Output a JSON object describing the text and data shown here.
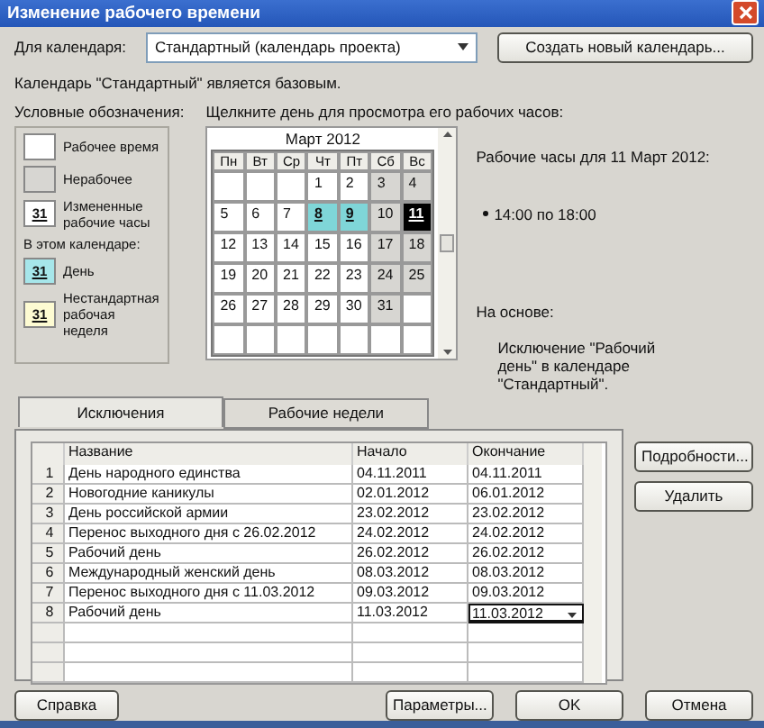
{
  "window": {
    "title": "Изменение рабочего времени"
  },
  "calendar_field": {
    "label": "Для календаря:",
    "value": "Стандартный (календарь проекта)"
  },
  "create_button": "Создать новый календарь...",
  "base_note": "Календарь \"Стандартный\" является базовым.",
  "legend": {
    "title": "Условные обозначения:",
    "items": [
      {
        "kind": "working",
        "label": "Рабочее время"
      },
      {
        "kind": "nonworking",
        "label": "Нерабочее"
      },
      {
        "kind": "changed",
        "mark": "31",
        "label": "Измененные рабочие часы"
      },
      {
        "kind": "heading",
        "label": "В этом календаре:"
      },
      {
        "kind": "exception",
        "mark": "31",
        "label": "День"
      },
      {
        "kind": "nonstandard",
        "mark": "31",
        "label": "Нестандартная рабочая неделя"
      }
    ]
  },
  "calendar": {
    "hint": "Щелкните день для просмотра его рабочих часов:",
    "month": "Март 2012",
    "weekdays": [
      "Пн",
      "Вт",
      "Ср",
      "Чт",
      "Пт",
      "Сб",
      "Вс"
    ],
    "weeks": [
      [
        {
          "kind": "empty",
          "selected": false
        },
        {
          "kind": "empty",
          "selected": false
        },
        {
          "kind": "empty",
          "selected": false
        },
        {
          "day": "1",
          "kind": "working",
          "selected": false
        },
        {
          "day": "2",
          "kind": "working",
          "selected": false
        },
        {
          "day": "3",
          "kind": "nonworking",
          "selected": false
        },
        {
          "day": "4",
          "kind": "nonworking",
          "selected": false
        }
      ],
      [
        {
          "day": "5",
          "kind": "working",
          "selected": false
        },
        {
          "day": "6",
          "kind": "working",
          "selected": false
        },
        {
          "day": "7",
          "kind": "working",
          "selected": false
        },
        {
          "day": "8",
          "kind": "exception",
          "selected": false
        },
        {
          "day": "9",
          "kind": "exception",
          "selected": false
        },
        {
          "day": "10",
          "kind": "nonworking",
          "selected": false
        },
        {
          "day": "11",
          "kind": "exception",
          "selected": true
        }
      ],
      [
        {
          "day": "12",
          "kind": "working",
          "selected": false
        },
        {
          "day": "13",
          "kind": "working",
          "selected": false
        },
        {
          "day": "14",
          "kind": "working",
          "selected": false
        },
        {
          "day": "15",
          "kind": "working",
          "selected": false
        },
        {
          "day": "16",
          "kind": "working",
          "selected": false
        },
        {
          "day": "17",
          "kind": "nonworking",
          "selected": false
        },
        {
          "day": "18",
          "kind": "nonworking",
          "selected": false
        }
      ],
      [
        {
          "day": "19",
          "kind": "working",
          "selected": false
        },
        {
          "day": "20",
          "kind": "working",
          "selected": false
        },
        {
          "day": "21",
          "kind": "working",
          "selected": false
        },
        {
          "day": "22",
          "kind": "working",
          "selected": false
        },
        {
          "day": "23",
          "kind": "working",
          "selected": false
        },
        {
          "day": "24",
          "kind": "nonworking",
          "selected": false
        },
        {
          "day": "25",
          "kind": "nonworking",
          "selected": false
        }
      ],
      [
        {
          "day": "26",
          "kind": "working",
          "selected": false
        },
        {
          "day": "27",
          "kind": "working",
          "selected": false
        },
        {
          "day": "28",
          "kind": "working",
          "selected": false
        },
        {
          "day": "29",
          "kind": "working",
          "selected": false
        },
        {
          "day": "30",
          "kind": "working",
          "selected": false
        },
        {
          "day": "31",
          "kind": "nonworking",
          "selected": false
        },
        {
          "kind": "empty",
          "selected": false
        }
      ],
      [
        {
          "kind": "empty",
          "selected": false
        },
        {
          "kind": "empty",
          "selected": false
        },
        {
          "kind": "empty",
          "selected": false
        },
        {
          "kind": "empty",
          "selected": false
        },
        {
          "kind": "empty",
          "selected": false
        },
        {
          "kind": "empty",
          "selected": false
        },
        {
          "kind": "empty",
          "selected": false
        }
      ]
    ]
  },
  "hours": {
    "title": "Рабочие часы для 11 Март 2012:",
    "items": [
      "14:00 по 18:00"
    ]
  },
  "based_on": {
    "title": "На основе:",
    "text": "Исключение \"Рабочий день\" в календаре \"Стандартный\"."
  },
  "tabs": [
    {
      "label": "Исключения",
      "selected": true
    },
    {
      "label": "Рабочие недели",
      "selected": false
    }
  ],
  "table": {
    "columns": [
      "Название",
      "Начало",
      "Окончание"
    ],
    "rows": [
      {
        "num": "1",
        "name": "День народного единства",
        "start": "04.11.2011",
        "end": "04.11.2011",
        "selected": false
      },
      {
        "num": "2",
        "name": "Новогодние каникулы",
        "start": "02.01.2012",
        "end": "06.01.2012",
        "selected": false
      },
      {
        "num": "3",
        "name": "День российской армии",
        "start": "23.02.2012",
        "end": "23.02.2012",
        "selected": false
      },
      {
        "num": "4",
        "name": "Перенос выходного дня с 26.02.2012",
        "start": "24.02.2012",
        "end": "24.02.2012",
        "selected": false
      },
      {
        "num": "5",
        "name": "Рабочий день",
        "start": "26.02.2012",
        "end": "26.02.2012",
        "selected": false
      },
      {
        "num": "6",
        "name": "Международный женский день",
        "start": "08.03.2012",
        "end": "08.03.2012",
        "selected": false
      },
      {
        "num": "7",
        "name": "Перенос выходного дня с 11.03.2012",
        "start": "09.03.2012",
        "end": "09.03.2012",
        "selected": false
      },
      {
        "num": "8",
        "name": "Рабочий день",
        "start": "11.03.2012",
        "end": "11.03.2012",
        "selected": true
      }
    ]
  },
  "side_buttons": [
    "Подробности...",
    "Удалить"
  ],
  "footer": {
    "help": "Справка",
    "buttons": [
      "Параметры...",
      "OK",
      "Отмена"
    ]
  }
}
